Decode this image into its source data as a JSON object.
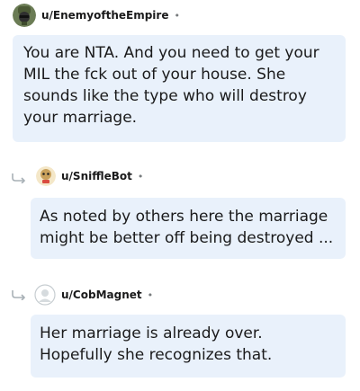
{
  "comments": [
    {
      "username": "u/EnemyoftheEmpire",
      "dot": "•",
      "avatar_icon": "soldier-avatar-icon",
      "text": "You are NTA. And you need to get your MIL the fck out of your house. She sounds like the type who will destroy your marriage."
    },
    {
      "username": "u/SniffleBot",
      "dot": "•",
      "avatar_icon": "bot-avatar-icon",
      "reply_icon": "reply-arrow-icon",
      "text": "As noted by others here the marriage might be better off being destroyed ..."
    },
    {
      "username": "u/CobMagnet",
      "dot": "•",
      "avatar_icon": "default-avatar-icon",
      "reply_icon": "reply-arrow-icon",
      "text": "Her marriage is already over. Hopefully she recognizes that."
    }
  ],
  "colors": {
    "bubble": "#e9f1fb",
    "text": "#1a1a1b",
    "meta": "#787c7e"
  }
}
